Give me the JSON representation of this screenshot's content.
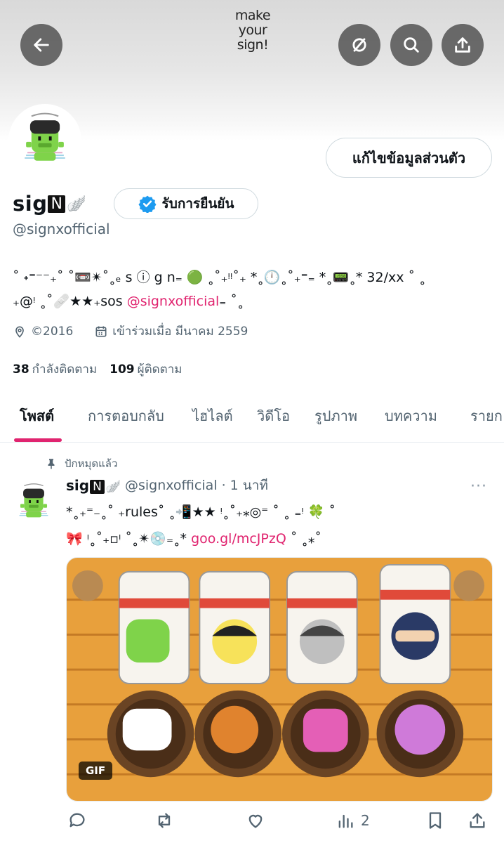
{
  "header": {
    "logo_text": [
      "make",
      "your",
      "sign!"
    ],
    "back_icon": "arrow-left-icon",
    "hide_icon": "eye-slash-icon",
    "search_icon": "search-icon",
    "share_icon": "share-icon"
  },
  "profile": {
    "edit_button_label": "แก้ไขข้อมูลส่วนตัว",
    "display_name": "sig",
    "display_name_boxed": "N",
    "display_name_tail": "🪽",
    "verified_label": "รับการยืนยัน",
    "handle": "@signxofficial",
    "bio_line1": "˚ ˖⁼⁻⁻₊˚ ˚📼✴˚˳ₑ s ⓘ g n₌ 🟢 ˳˚₊ᵎᵎ˚₊ *˳🕛˳˚₊⁼₌ *˳📟˳* 32/xx ˚ ˳",
    "bio_line2_pre": "₊@ᵎ ˳˚🩹★★₊sos ",
    "bio_line2_link": "@signxofficial",
    "bio_line2_post": "₌ ˚˳",
    "location": "©2016",
    "joined": "เข้าร่วมเมื่อ มีนาคม 2559",
    "following_count": "38",
    "following_label": "กำลังติดตาม",
    "followers_count": "109",
    "followers_label": "ผู้ติดตาม"
  },
  "tabs": [
    {
      "label": "โพสต์",
      "active": true
    },
    {
      "label": "การตอบกลับ"
    },
    {
      "label": "ไฮไลต์"
    },
    {
      "label": "วิดีโอ"
    },
    {
      "label": "รูปภาพ"
    },
    {
      "label": "บทความ"
    },
    {
      "label": "รายก"
    }
  ],
  "tweet": {
    "pinned_label": "ปักหมุดแล้ว",
    "name": "sig",
    "name_boxed": "N",
    "name_tail": "🪽",
    "handle": "@signxofficial",
    "time": "· 1 นาที",
    "more": "···",
    "line1": "*˳₊⁼₋˳˚ ₊rules˚ ˳📲★★ ᵎ˳˚₊⁎◎⁼ ˚ ˳ ₌ᵎ 🍀 ˚",
    "line2_pre": "🎀 ᵎ˳˚₊▫ᵎ ˚˳✴💿₌˳* ",
    "line2_link": "goo.gl/mcJPzQ",
    "line2_post": " ˚ ˳⁎˚",
    "gif_badge": "GIF",
    "views": "2"
  },
  "colors": {
    "accent_pink": "#e0246f",
    "verified_blue": "#1d9bf0",
    "muted": "#536471"
  }
}
